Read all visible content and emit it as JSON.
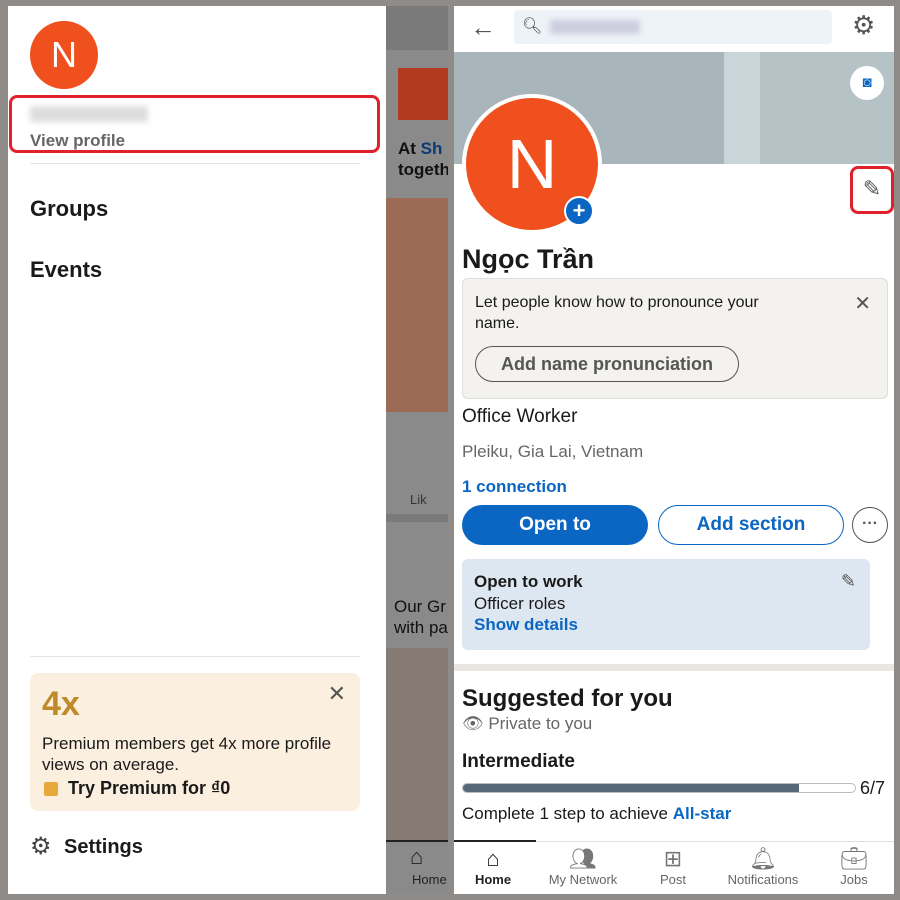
{
  "left_menu": {
    "avatar_letter": "N",
    "view_profile": "View profile",
    "items": [
      "Groups",
      "Events"
    ],
    "premium": {
      "headline": "4x",
      "text": "Premium members get 4x more profile views on average.",
      "cta": "Try Premium for ₫0"
    },
    "settings": "Settings"
  },
  "background_feed": {
    "text1a": "At ",
    "text1b": "Sh",
    "text1c": "togeth",
    "like": "Lik",
    "text2": "Our Gr",
    "text3": "with pa",
    "nav_home": "Home"
  },
  "profile": {
    "avatar_letter": "N",
    "name": "Ngọc Trần",
    "pronounce": {
      "text": "Let people know how to pronounce your name.",
      "button": "Add name pronunciation"
    },
    "headline": "Office Worker",
    "location": "Pleiku, Gia Lai, Vietnam",
    "connections": "1 connection",
    "buttons": {
      "open_to": "Open to",
      "add_section": "Add section"
    },
    "open_to_work": {
      "title": "Open to work",
      "roles": "Officer roles",
      "link": "Show details"
    },
    "suggested": {
      "title": "Suggested for you",
      "privacy": "Private to you",
      "level": "Intermediate",
      "progress": "6/7",
      "progress_fraction": 0.857,
      "complete_text": "Complete 1 step to achieve ",
      "complete_link": "All-star"
    }
  },
  "bottom_nav": [
    "Home",
    "My Network",
    "Post",
    "Notifications",
    "Jobs"
  ],
  "colors": {
    "accent": "#0a66c2",
    "avatar": "#f0501e",
    "highlight": "#e0202a"
  }
}
